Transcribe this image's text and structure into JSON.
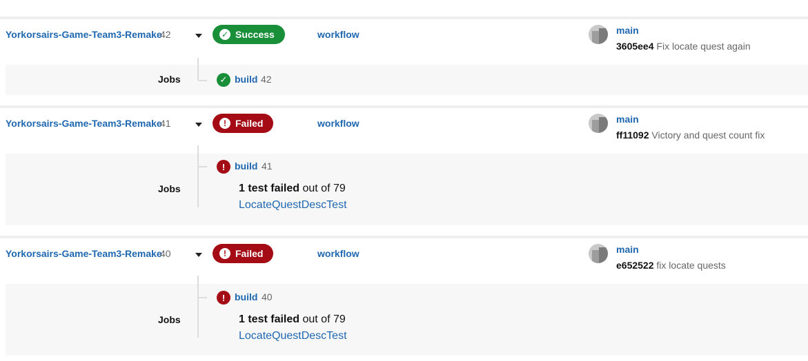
{
  "runs": [
    {
      "repo": "Yorkorsairs-Game-Team3-Remake",
      "number": "42",
      "status": "Success",
      "status_icon": "check-circle-icon",
      "workflow": "workflow",
      "branch": "main",
      "sha": "3605ee4",
      "message": "Fix locate quest again",
      "jobs_label": "Jobs",
      "job": {
        "name": "build",
        "number": "42",
        "status": "success"
      }
    },
    {
      "repo": "Yorkorsairs-Game-Team3-Remake",
      "number": "41",
      "status": "Failed",
      "status_icon": "exclamation-circle-icon",
      "workflow": "workflow",
      "branch": "main",
      "sha": "ff11092",
      "message": "Victory and quest count fix",
      "jobs_label": "Jobs",
      "job": {
        "name": "build",
        "number": "41",
        "status": "failed",
        "failed_count": "1 test failed",
        "out_of": "out of 79",
        "failed_test": "LocateQuestDescTest"
      }
    },
    {
      "repo": "Yorkorsairs-Game-Team3-Remake",
      "number": "40",
      "status": "Failed",
      "status_icon": "exclamation-circle-icon",
      "workflow": "workflow",
      "branch": "main",
      "sha": "e652522",
      "message": "fix locate quests",
      "jobs_label": "Jobs",
      "job": {
        "name": "build",
        "number": "40",
        "status": "failed",
        "failed_count": "1 test failed",
        "out_of": "out of 79",
        "failed_test": "LocateQuestDescTest"
      }
    }
  ],
  "colors": {
    "success": "#1a8f3a",
    "failed": "#a40b14",
    "link": "#1f67b0"
  }
}
